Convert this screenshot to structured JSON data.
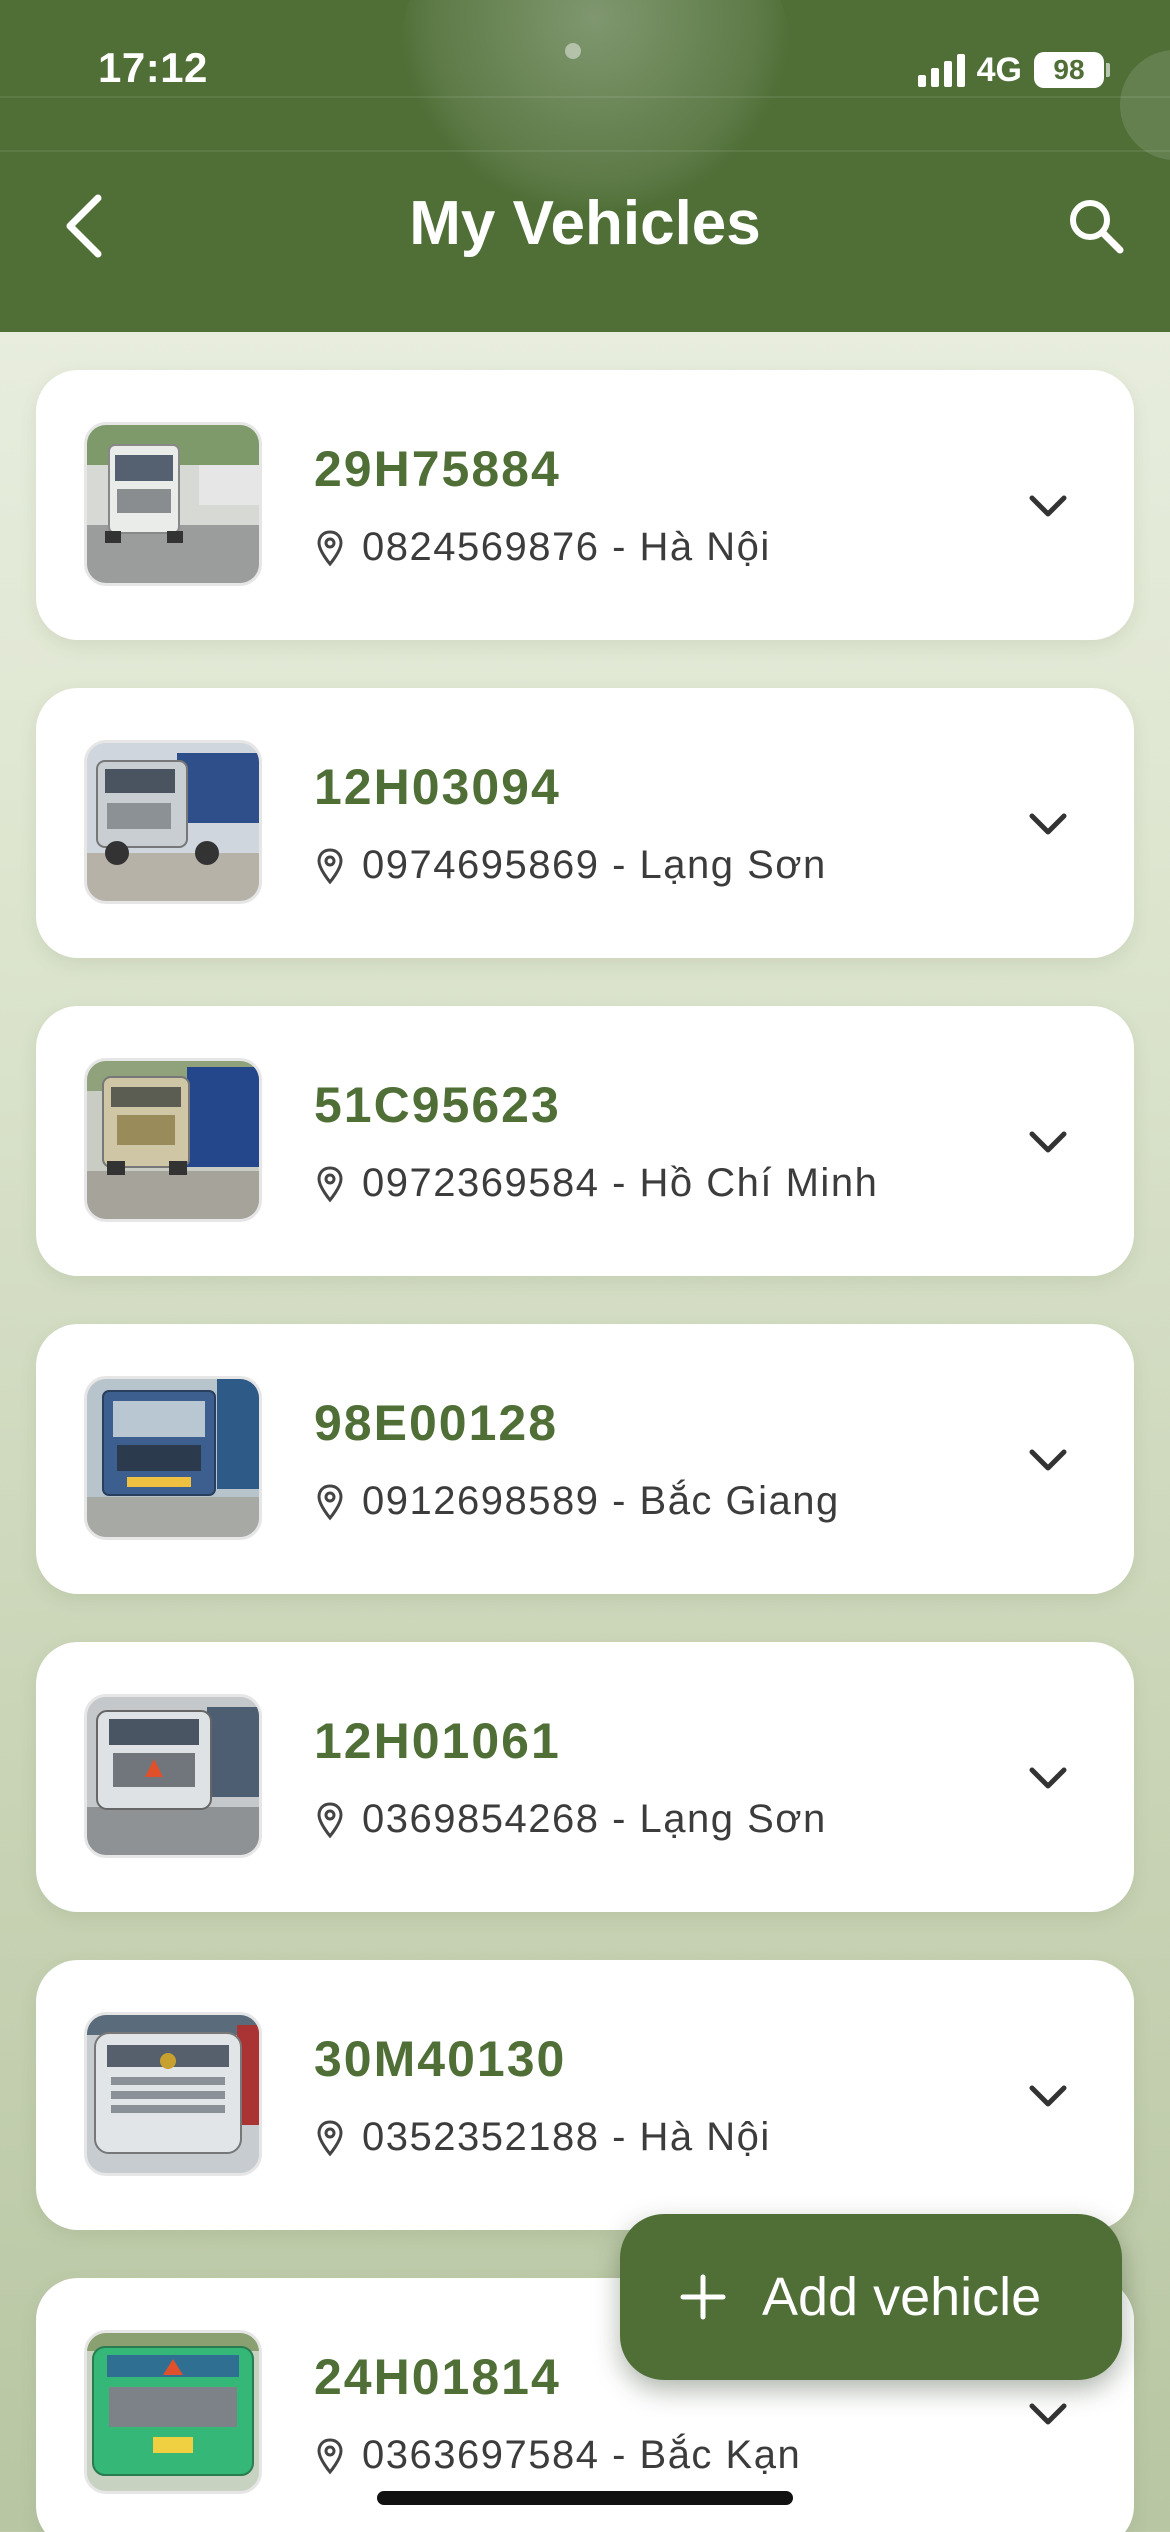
{
  "status_bar": {
    "time": "17:12",
    "network": "4G",
    "battery": "98"
  },
  "header": {
    "title": "My Vehicles"
  },
  "vehicles": [
    {
      "plate": "29H75884",
      "phone": "0824569876",
      "location": "Hà Nội",
      "meta": "0824569876 - Hà Nội",
      "photo_color": "#d7d9d5",
      "truck_color": "#e9ece8"
    },
    {
      "plate": "12H03094",
      "phone": "0974695869",
      "location": "Lạng Sơn",
      "meta": "0974695869 - Lạng Sơn",
      "photo_color": "#cfd6de",
      "truck_color": "#c9ced3"
    },
    {
      "plate": "51C95623",
      "phone": "0972369584",
      "location": "Hồ Chí Minh",
      "meta": "0972369584 - Hồ Chí Minh",
      "photo_color": "#c9ccc2",
      "truck_color": "#cfc6a6"
    },
    {
      "plate": "98E00128",
      "phone": "0912698589",
      "location": "Bắc Giang",
      "meta": "0912698589 - Bắc Giang",
      "photo_color": "#b8c4cc",
      "truck_color": "#3c5f8f"
    },
    {
      "plate": "12H01061",
      "phone": "0369854268",
      "location": "Lạng Sơn",
      "meta": "0369854268 - Lạng Sơn",
      "photo_color": "#c4c8cb",
      "truck_color": "#dfe2e4"
    },
    {
      "plate": "30M40130",
      "phone": "0352352188",
      "location": "Hà Nội",
      "meta": "0352352188 - Hà Nội",
      "photo_color": "#c6ccd0",
      "truck_color": "#e2e5e7"
    },
    {
      "plate": "24H01814",
      "phone": "0363697584",
      "location": "Bắc Kạn",
      "meta": "0363697584 - Bắc Kạn",
      "photo_color": "#c8d2c0",
      "truck_color": "#34b777"
    }
  ],
  "fab": {
    "label": "Add vehicle"
  },
  "icons": {
    "back": "chevron-left-icon",
    "search": "search-icon",
    "location": "location-pin-icon",
    "expand": "chevron-down-icon",
    "add": "plus-icon"
  },
  "colors": {
    "accent": "#4f6f37",
    "plate_text": "#4f6f37",
    "card_bg": "#ffffff"
  }
}
